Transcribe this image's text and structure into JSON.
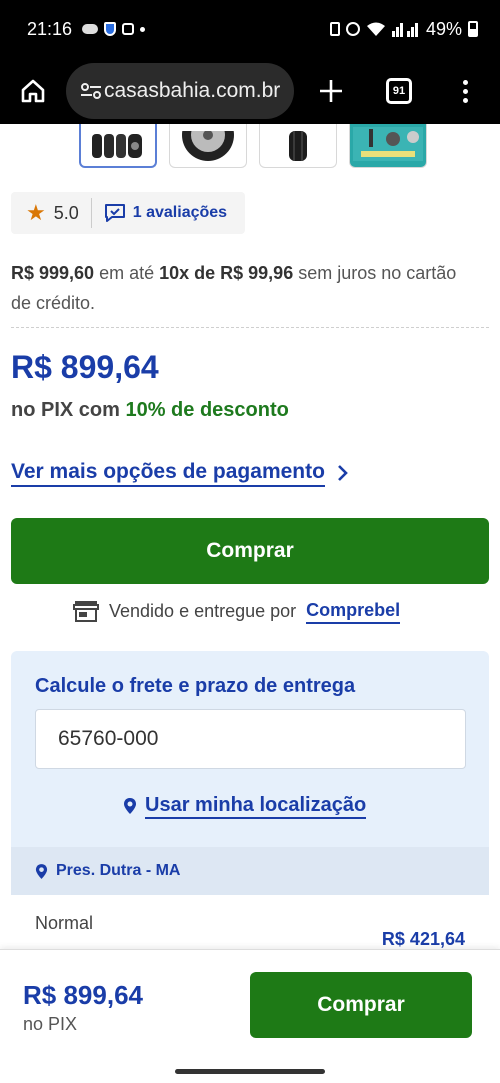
{
  "status_bar": {
    "time": "21:16",
    "battery": "49%"
  },
  "browser": {
    "url": "casasbahia.com.br",
    "tab_count": "91"
  },
  "gallery": {
    "thumbnails": [
      "tires-set",
      "wheel",
      "tire-side",
      "installation-kit"
    ]
  },
  "rating": {
    "score": "5.0",
    "reviews_label": "1 avaliações"
  },
  "pricing": {
    "full_price": "R$ 999,60",
    "installments_text_1": " em até ",
    "installments_count": "10x de R$ 99,96",
    "installments_text_2": " sem juros no cartão de crédito.",
    "pix_price": "R$ 899,64",
    "pix_prefix": "no PIX com ",
    "pix_discount": "10% de desconto",
    "more_payment_label": "Ver mais opções de pagamento"
  },
  "actions": {
    "buy_label": "Comprar"
  },
  "seller": {
    "prefix": "Vendido e entregue por",
    "name": "Comprebel"
  },
  "freight": {
    "title": "Calcule o frete e prazo de entrega",
    "cep_value": "65760-000",
    "use_location_label": "Usar minha localização",
    "city": "Pres. Dutra - MA",
    "option_name": "Normal",
    "option_price": "R$ 421,64"
  },
  "bottom_bar": {
    "price": "R$ 899,64",
    "sub": "no PIX",
    "buy_label": "Comprar"
  },
  "colors": {
    "brand_blue": "#1a3da8",
    "buy_green": "#1e7a16",
    "discount_green": "#1e7a1e",
    "star": "#d97706"
  }
}
